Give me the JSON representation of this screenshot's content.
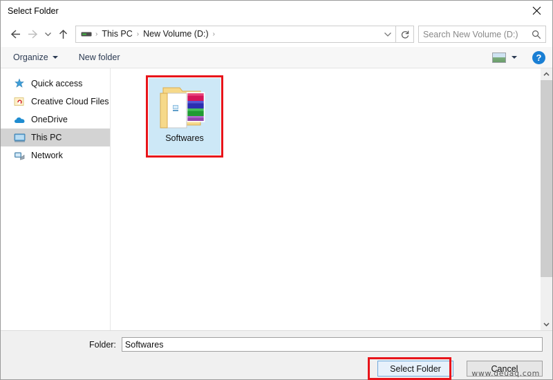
{
  "window": {
    "title": "Select Folder",
    "close_icon": "close-icon"
  },
  "navigation": {
    "back_icon": "back-arrow-icon",
    "forward_icon": "forward-arrow-icon",
    "recent_icon": "chevron-down-icon",
    "up_icon": "up-arrow-icon",
    "drive_icon": "drive-icon",
    "breadcrumbs": [
      {
        "label": "This PC"
      },
      {
        "label": "New Volume (D:)"
      }
    ],
    "separator": "›",
    "address_chevron_icon": "chevron-down-icon",
    "refresh_icon": "refresh-icon"
  },
  "search": {
    "placeholder": "Search New Volume (D:)",
    "icon": "search-icon"
  },
  "toolbar": {
    "organize_label": "Organize",
    "new_folder_label": "New folder",
    "view_icon": "view-layout-icon",
    "view_caret_icon": "chevron-down-icon",
    "help_label": "?",
    "help_icon": "help-icon"
  },
  "sidebar": {
    "items": [
      {
        "label": "Quick access",
        "icon": "star-icon",
        "selected": false
      },
      {
        "label": "Creative Cloud Files",
        "icon": "creative-cloud-folder-icon",
        "selected": false
      },
      {
        "label": "OneDrive",
        "icon": "cloud-icon",
        "selected": false
      },
      {
        "label": "This PC",
        "icon": "monitor-icon",
        "selected": true
      },
      {
        "label": "Network",
        "icon": "network-icon",
        "selected": false
      }
    ]
  },
  "filepane": {
    "items": [
      {
        "label": "Softwares",
        "icon": "folder-icon",
        "selected": true,
        "highlighted": true
      }
    ],
    "scrollbar": {
      "up_icon": "scroll-up-icon",
      "down_icon": "scroll-down-icon"
    }
  },
  "bottom": {
    "folder_label": "Folder:",
    "folder_value": "Softwares",
    "select_button": "Select Folder",
    "cancel_button": "Cancel"
  },
  "watermark": {
    "text": "www.deuaq.com"
  },
  "colors": {
    "highlight_red": "#e8141a",
    "selection_blue": "#cde8f7",
    "sidebar_selected": "#d3d3d3",
    "primary_button": "#e7f1fb",
    "accent_blue": "#1a7fd4"
  }
}
